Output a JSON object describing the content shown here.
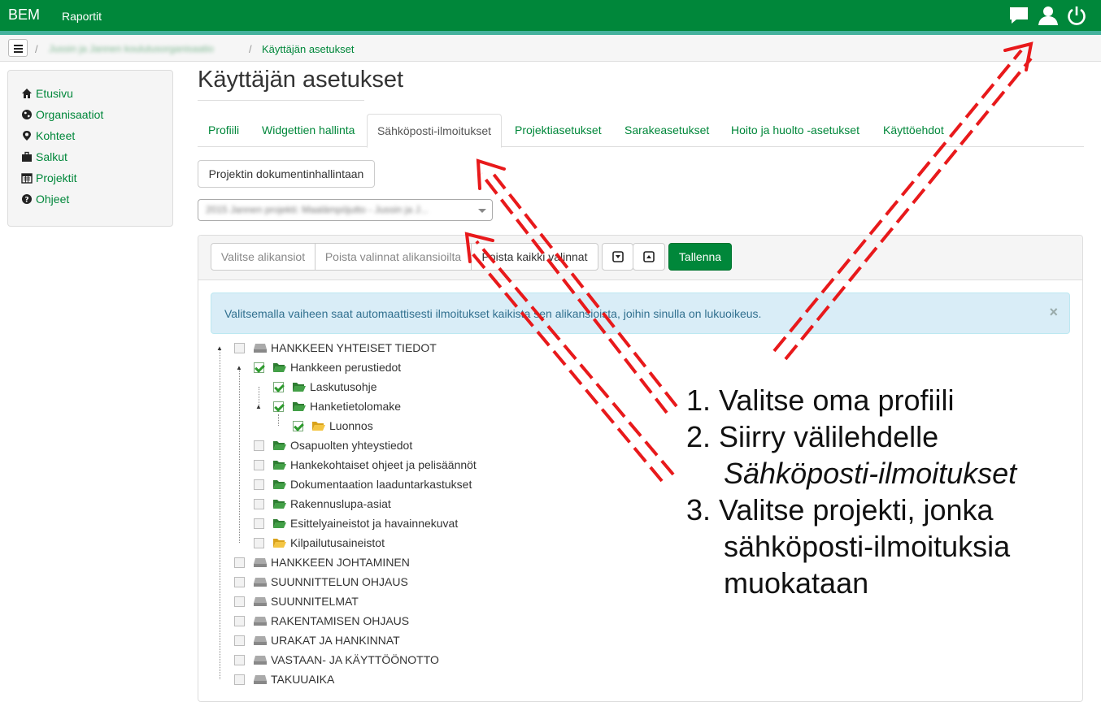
{
  "header": {
    "brand": "BEM",
    "nav_reports": "Raportit",
    "icons": [
      "chat-icon",
      "user-icon",
      "power-icon"
    ]
  },
  "breadcrumb": {
    "org_blurred": "Jussin ja Jannen koulutusorganisaatio",
    "current": "Käyttäjän asetukset"
  },
  "sidebar": {
    "items": [
      {
        "label": "Etusivu",
        "icon": "home-icon"
      },
      {
        "label": "Organisaatiot",
        "icon": "globe-icon"
      },
      {
        "label": "Kohteet",
        "icon": "map-marker-icon"
      },
      {
        "label": "Salkut",
        "icon": "briefcase-icon"
      },
      {
        "label": "Projektit",
        "icon": "calendar-icon"
      },
      {
        "label": "Ohjeet",
        "icon": "question-icon"
      }
    ]
  },
  "page": {
    "title": "Käyttäjän asetukset"
  },
  "tabs": [
    {
      "label": "Profiili"
    },
    {
      "label": "Widgettien hallinta"
    },
    {
      "label": "Sähköposti-ilmoitukset",
      "active": true
    },
    {
      "label": "Projektiasetukset"
    },
    {
      "label": "Sarakeasetukset"
    },
    {
      "label": "Hoito ja huolto -asetukset"
    },
    {
      "label": "Käyttöehdot"
    }
  ],
  "buttons": {
    "doc_mgmt": "Projektin dokumentinhallintaan",
    "select_subfolders": "Valitse alikansiot",
    "clear_subfolders": "Poista valinnat alikansioilta",
    "clear_all": "Poista kaikki valinnat",
    "save": "Tallenna"
  },
  "project_select": {
    "value_blurred": "2015 Jannen projekti: Maalämpöjutto - Jussin ja J..."
  },
  "alert": {
    "message": "Valitsemalla vaiheen saat automaattisesti ilmoitukset kaikista sen alikansioista, joihin sinulla on lukuoikeus.",
    "close": "×"
  },
  "tree": [
    {
      "label": "HANKKEEN YHTEISET TIEDOT",
      "checked": false,
      "icon": "drive-icon"
    },
    {
      "label": "Hankkeen perustiedot",
      "checked": true,
      "icon": "folder-open-icon"
    },
    {
      "label": "Laskutusohje",
      "checked": true,
      "icon": "folder-open-icon"
    },
    {
      "label": "Hanketietolomake",
      "checked": true,
      "icon": "folder-open-icon"
    },
    {
      "label": "Luonnos",
      "checked": true,
      "icon": "folder-yellow-icon"
    },
    {
      "label": "Osapuolten yhteystiedot",
      "checked": false,
      "icon": "folder-open-icon"
    },
    {
      "label": "Hankekohtaiset ohjeet ja pelisäännöt",
      "checked": false,
      "icon": "folder-open-icon"
    },
    {
      "label": "Dokumentaation laaduntarkastukset",
      "checked": false,
      "icon": "folder-open-icon"
    },
    {
      "label": "Rakennuslupa-asiat",
      "checked": false,
      "icon": "folder-open-icon"
    },
    {
      "label": "Esittelyaineistot ja havainnekuvat",
      "checked": false,
      "icon": "folder-open-icon"
    },
    {
      "label": "Kilpailutusaineistot",
      "checked": false,
      "icon": "folder-yellow-icon"
    },
    {
      "label": "HANKKEEN JOHTAMINEN",
      "checked": false,
      "icon": "drive-icon"
    },
    {
      "label": "SUUNNITTELUN OHJAUS",
      "checked": false,
      "icon": "drive-icon"
    },
    {
      "label": "SUUNNITELMAT",
      "checked": false,
      "icon": "drive-icon"
    },
    {
      "label": "RAKENTAMISEN OHJAUS",
      "checked": false,
      "icon": "drive-icon"
    },
    {
      "label": "URAKAT JA HANKINNAT",
      "checked": false,
      "icon": "drive-icon"
    },
    {
      "label": "VASTAAN- JA KÄYTTÖÖNOTTO",
      "checked": false,
      "icon": "drive-icon"
    },
    {
      "label": "TAKUUAIKA",
      "checked": false,
      "icon": "drive-icon"
    }
  ],
  "instructions": {
    "line1": "1. Valitse oma profiili",
    "line2a": "2. Siirry välilehdelle",
    "line2b": "Sähköposti-ilmoitukset",
    "line3a": "3. Valitse projekti, jonka",
    "line3b": "sähköposti-ilmoituksia",
    "line3c": "muokataan"
  },
  "colors": {
    "brand_green": "#00873a",
    "stripe": "#45b29d",
    "annotation_red": "#e8191b"
  }
}
